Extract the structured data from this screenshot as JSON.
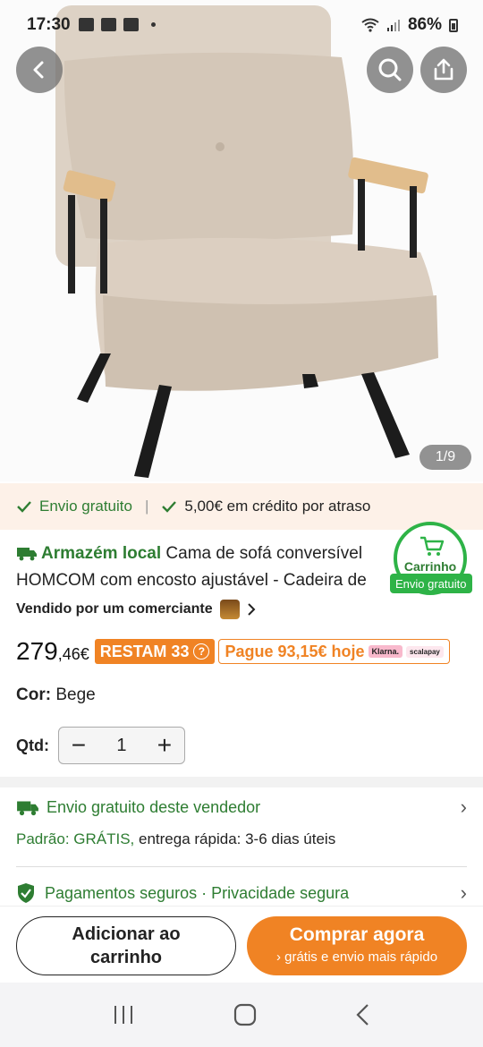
{
  "status_bar": {
    "time": "17:30",
    "battery": "86%"
  },
  "gallery": {
    "counter": "1/9"
  },
  "promo": {
    "free_shipping": "Envio gratuito",
    "credit": "5,00€ em crédito por atraso"
  },
  "product": {
    "store_label": "Armazém local",
    "title": "Cama de sofá conversível HOMCOM com encosto ajustável - Cadeira de",
    "seller": "Vendido por um comerciante",
    "price_int": "279",
    "price_dec": ",46€",
    "restam": "RESTAM 33",
    "pay_today": "Pague 93,15€ hoje",
    "klarna": "Klarna.",
    "scalapay": "scalapay",
    "color_label": "Cor:",
    "color_value": "Bege",
    "qty_label": "Qtd:",
    "qty_value": "1"
  },
  "cart_badge": {
    "label": "Carrinho",
    "tag": "Envio gratuito"
  },
  "shipping": {
    "title": "Envio gratuito deste vendedor",
    "standard": "Padrão: GRÁTIS,",
    "delivery": "entrega rápida: 3-6 dias úteis"
  },
  "payments": {
    "text": "Pagamentos seguros · Privacidade segura"
  },
  "actions": {
    "add_cart": "Adicionar ao carrinho",
    "buy_now": "Comprar agora",
    "buy_now_sub": "› grátis e envio mais rápido"
  },
  "colors": {
    "accent": "#f08324",
    "green": "#2e7d32",
    "sofa": "#d9cdbf"
  }
}
